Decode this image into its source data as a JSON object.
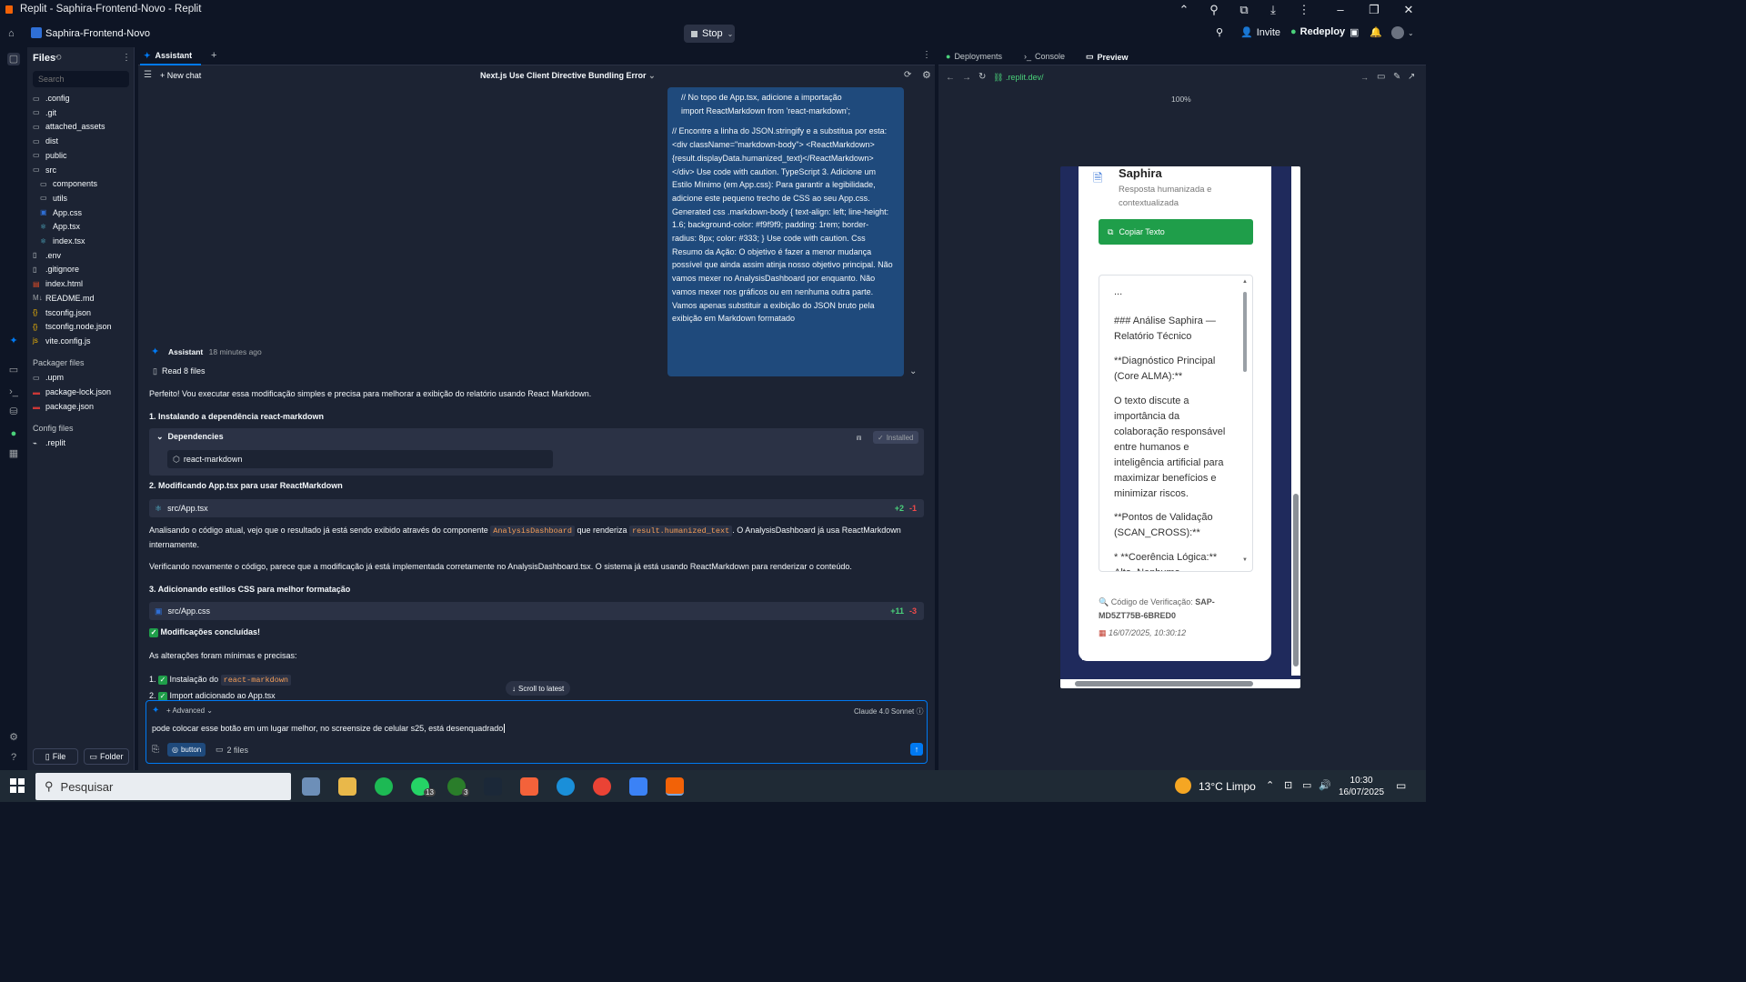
{
  "window": {
    "title": "Replit - Saphira-Frontend-Novo - Replit"
  },
  "topbar": {
    "repl_name": "Saphira-Frontend-Novo",
    "stop_label": "Stop",
    "invite_label": "Invite",
    "redeploy_label": "Redeploy"
  },
  "files": {
    "header": "Files",
    "search_placeholder": "Search",
    "tree": [
      {
        "name": ".config",
        "type": "folder",
        "depth": 0
      },
      {
        "name": ".git",
        "type": "folder",
        "depth": 0
      },
      {
        "name": "attached_assets",
        "type": "folder",
        "depth": 0
      },
      {
        "name": "dist",
        "type": "folder",
        "depth": 0
      },
      {
        "name": "public",
        "type": "folder",
        "depth": 0
      },
      {
        "name": "src",
        "type": "folder-open",
        "depth": 0
      },
      {
        "name": "components",
        "type": "folder",
        "depth": 1
      },
      {
        "name": "utils",
        "type": "folder",
        "depth": 1
      },
      {
        "name": "App.css",
        "type": "css",
        "depth": 1
      },
      {
        "name": "App.tsx",
        "type": "react",
        "depth": 1
      },
      {
        "name": "index.tsx",
        "type": "react",
        "depth": 1
      },
      {
        "name": ".env",
        "type": "file",
        "depth": 0
      },
      {
        "name": ".gitignore",
        "type": "file",
        "depth": 0
      },
      {
        "name": "index.html",
        "type": "html",
        "depth": 0
      },
      {
        "name": "README.md",
        "type": "md",
        "depth": 0
      },
      {
        "name": "tsconfig.json",
        "type": "json",
        "depth": 0
      },
      {
        "name": "tsconfig.node.json",
        "type": "json",
        "depth": 0
      },
      {
        "name": "vite.config.js",
        "type": "js",
        "depth": 0
      }
    ],
    "packager_label": "Packager files",
    "packager": [
      {
        "name": ".upm",
        "type": "folder"
      },
      {
        "name": "package-lock.json",
        "type": "npm"
      },
      {
        "name": "package.json",
        "type": "npm"
      }
    ],
    "config_label": "Config files",
    "config": [
      {
        "name": ".replit",
        "type": "replit"
      }
    ],
    "new_file": "File",
    "new_folder": "Folder"
  },
  "assistant": {
    "tab_label": "Assistant",
    "new_chat": "New chat",
    "chat_title": "Next.js Use Client Directive Bundling Error",
    "user_message_lines": [
      "// No topo de App.tsx, adicione a importação",
      "import ReactMarkdown from 'react-markdown';",
      "",
      "// Encontre a linha do JSON.stringify e a substitua por esta:",
      "<div className=\"markdown-body\"> <ReactMarkdown>",
      "{result.displayData.humanized_text}</ReactMarkdown>",
      "</div> Use code with caution. TypeScript 3. Adicione um",
      "Estilo Mínimo (em App.css): Para garantir a legibilidade,",
      "adicione este pequeno trecho de CSS ao seu App.css.",
      "Generated css .markdown-body { text-align: left; line-height:",
      "1.6; background-color: #f9f9f9; padding: 1rem; border-",
      "radius: 8px; color: #333; } Use code with caution. Css",
      "Resumo da Ação: O objetivo é fazer a menor mudança",
      "possível que ainda assim atinja nosso objetivo principal. Não",
      "vamos mexer no AnalysisDashboard por enquanto. Não",
      "vamos mexer nos gráficos ou em nenhuma outra parte.",
      "Vamos apenas substituir a exibição do JSON bruto pela",
      "exibição em Markdown formatado"
    ],
    "reply_author": "Assistant",
    "reply_time": "18 minutes ago",
    "read_files": "Read 8 files",
    "intro": "Perfeito! Vou executar essa modificação simples e precisa para melhorar a exibição do relatório usando React Markdown.",
    "step1": "1. Instalando a dependência react-markdown",
    "deps_label": "Dependencies",
    "installed_label": "Installed",
    "dep_name": "react-markdown",
    "step2": "2. Modificando App.tsx para usar ReactMarkdown",
    "file1": {
      "name": "src/App.tsx",
      "add": "+2",
      "del": "-1"
    },
    "para1_a": "Analisando o código atual, vejo que o resultado já está sendo exibido através do componente",
    "para1_code1": "AnalysisDashboard",
    "para1_b": "que renderiza",
    "para1_code2": "result.humanized_text",
    "para1_c": ". O AnalysisDashboard já usa ReactMarkdown",
    "para1_d": "internamente.",
    "para2": "Verificando novamente o código, parece que a modificação já está implementada corretamente no AnalysisDashboard.tsx. O sistema já está usando ReactMarkdown para renderizar o conteúdo.",
    "step3": "3. Adicionando estilos CSS para melhor formatação",
    "file2": {
      "name": "src/App.css",
      "add": "+11",
      "del": "-3"
    },
    "done": "Modificações concluídas!",
    "summary": "As alterações foram mínimas e precisas:",
    "list1_prefix": "1.",
    "list1_text": "Instalação do",
    "list1_code": "react-markdown",
    "list2_prefix": "2.",
    "list2_text": "Import adicionado ao App.tsx",
    "scroll_latest": "Scroll to latest",
    "advanced": "Advanced",
    "model": "Claude 4.0 Sonnet",
    "input_value": "pode colocar esse botão em um lugar melhor, no screensize de celular s25, está desenquadrado",
    "chip_button": "button",
    "chip_files": "2 files"
  },
  "right": {
    "tabs": [
      "Deployments",
      "Console",
      "Preview"
    ],
    "url": ".replit.dev/",
    "zoom": "100%",
    "preview": {
      "app_title": "Saphira",
      "app_subtitle_1": "Resposta humanizada e",
      "app_subtitle_2": "contextualizada",
      "copy_button": "Copiar Texto",
      "md_lines": [
        "...",
        "### Análise Saphira —",
        "Relatório Técnico",
        "**Diagnóstico Principal",
        "(Core ALMA):**",
        "O texto discute a",
        "importância da",
        "colaboração responsável",
        "entre humanos e",
        "inteligência artificial para",
        "maximizar benefícios e",
        "minimizar riscos.",
        "**Pontos de Validação",
        "(SCAN_CROSS):**",
        "* **Coerência Lógica:**",
        "Alta. Nenhuma"
      ],
      "verify_prefix": "🔍 Código de Verificação:",
      "verify_code_1": "SAP-",
      "verify_code_2": "MD5ZT75B-6BRED0",
      "timestamp": "16/07/2025, 10:30:12"
    }
  },
  "taskbar": {
    "search_placeholder": "Pesquisar",
    "whatsapp_badge": "13",
    "xbox_badge": "3",
    "weather_temp": "13°C",
    "weather_text": "Limpo",
    "time": "10:30",
    "date": "16/07/2025"
  },
  "colors": {
    "bg": "#0e1525",
    "panel": "#1c2333",
    "accent": "#0079f2",
    "user_bubble": "#1f4a7c",
    "green": "#1f9e4a"
  }
}
